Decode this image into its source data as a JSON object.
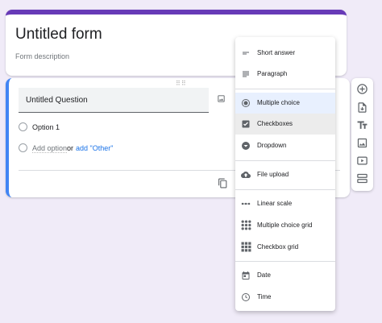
{
  "form": {
    "title": "Untitled form",
    "description": "Form description",
    "accent_color": "#673ab7"
  },
  "question": {
    "title": "Untitled Question",
    "option1": "Option 1",
    "add_option": "Add option",
    "or": "or",
    "add_other": "add \"Other\"",
    "active_color": "#4285f4"
  },
  "menu": {
    "items": [
      {
        "label": "Short answer",
        "icon": "short-answer-icon"
      },
      {
        "label": "Paragraph",
        "icon": "paragraph-icon"
      },
      {
        "label": "Multiple choice",
        "icon": "radio-icon",
        "selected": true
      },
      {
        "label": "Checkboxes",
        "icon": "checkbox-icon",
        "hovered": true
      },
      {
        "label": "Dropdown",
        "icon": "dropdown-icon"
      },
      {
        "label": "File upload",
        "icon": "cloud-upload-icon"
      },
      {
        "label": "Linear scale",
        "icon": "linear-scale-icon"
      },
      {
        "label": "Multiple choice grid",
        "icon": "grid-icon"
      },
      {
        "label": "Checkbox grid",
        "icon": "grid-icon"
      },
      {
        "label": "Date",
        "icon": "calendar-icon"
      },
      {
        "label": "Time",
        "icon": "clock-icon"
      }
    ]
  },
  "toolbar": {
    "icons": [
      "add-question-icon",
      "import-questions-icon",
      "add-title-icon",
      "add-image-icon",
      "add-video-icon",
      "add-section-icon"
    ]
  }
}
